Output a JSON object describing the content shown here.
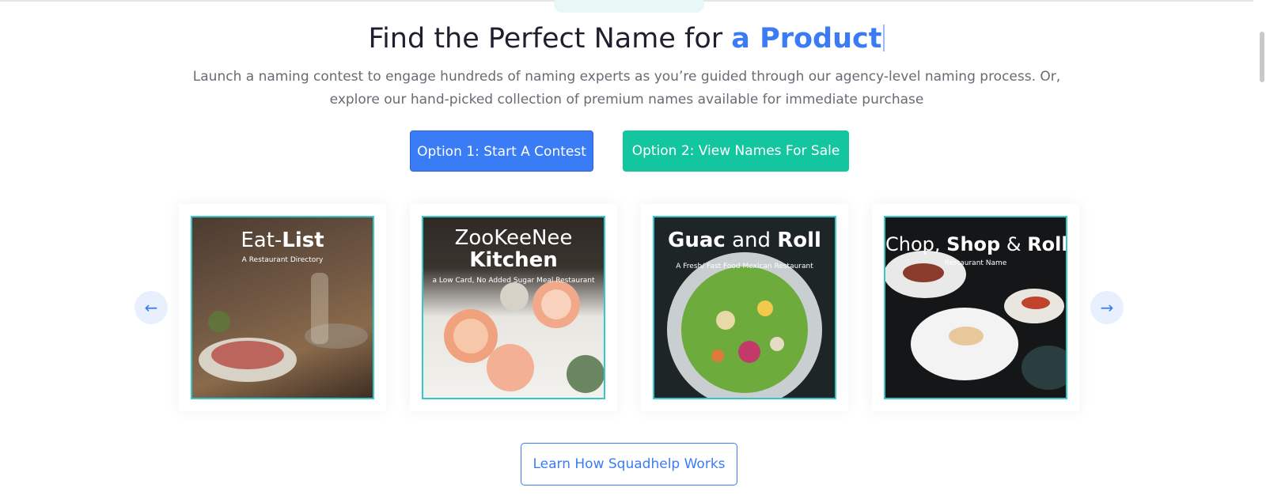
{
  "headline": {
    "prefix": "Find the Perfect Name for ",
    "accent": "a Product"
  },
  "subtext": "Launch a naming contest to engage hundreds of naming experts as you’re guided through our agency-level naming process. Or, explore our hand-picked collection of premium names available for immediate purchase",
  "buttons": {
    "option1": "Option 1: Start A Contest",
    "option2": "Option 2: View Names For Sale"
  },
  "cards": [
    {
      "title_a": "Eat-",
      "title_b": "List",
      "subtitle": "A Restaurant Directory"
    },
    {
      "title_a": "ZooKeeNee",
      "title_b": "Kitchen",
      "subtitle": "a Low Card, No Added Sugar Meal Restaurant"
    },
    {
      "title_a": "Guac",
      "title_mid": " and ",
      "title_b": "Roll",
      "subtitle": "A Fresh/ Fast Food Mexican Restaurant"
    },
    {
      "title_a": "Chop, ",
      "title_mid": "Shop",
      "title_c": " & ",
      "title_b": "Roll",
      "subtitle": "Restaurant Name"
    }
  ],
  "carousel": {
    "prev_icon": "arrow-left-icon",
    "next_icon": "arrow-right-icon"
  },
  "learn_button": "Learn How Squadhelp Works",
  "colors": {
    "accent_blue": "#3a7cf6",
    "accent_teal": "#13c6a0",
    "card_border": "#38c7c9"
  }
}
